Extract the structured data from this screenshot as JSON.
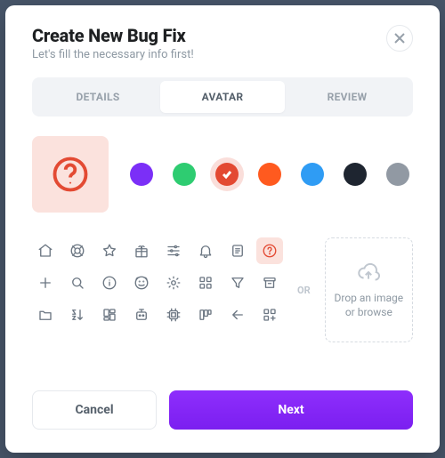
{
  "header": {
    "title": "Create New Bug Fix",
    "subtitle": "Let's fill the necessary info first!"
  },
  "tabs": {
    "details": "DETAILS",
    "avatar": "AVATAR",
    "review": "REVIEW",
    "active": "avatar"
  },
  "colors": [
    {
      "name": "purple",
      "hex": "#7b2ff7",
      "selected": false
    },
    {
      "name": "green",
      "hex": "#2ecc71",
      "selected": false
    },
    {
      "name": "red",
      "hex": "#e34a33",
      "selected": true
    },
    {
      "name": "orange",
      "hex": "#ff5a1f",
      "selected": false
    },
    {
      "name": "blue",
      "hex": "#2f9cf4",
      "selected": false
    },
    {
      "name": "black",
      "hex": "#1e2530",
      "selected": false
    },
    {
      "name": "gray",
      "hex": "#9199a3",
      "selected": false
    }
  ],
  "selected_icon": "question",
  "icons": [
    "home",
    "lifebuoy",
    "star",
    "gift",
    "sliders",
    "bell",
    "note",
    "question",
    "plus",
    "search",
    "info",
    "face",
    "cog",
    "grid",
    "funnel",
    "archive",
    "folder",
    "sort-az",
    "dashboard",
    "robot",
    "chip",
    "kanban",
    "back",
    "grid-plus"
  ],
  "dropzone": {
    "or": "OR",
    "line1": "Drop an image",
    "line2": "or browse"
  },
  "footer": {
    "cancel": "Cancel",
    "next": "Next"
  }
}
